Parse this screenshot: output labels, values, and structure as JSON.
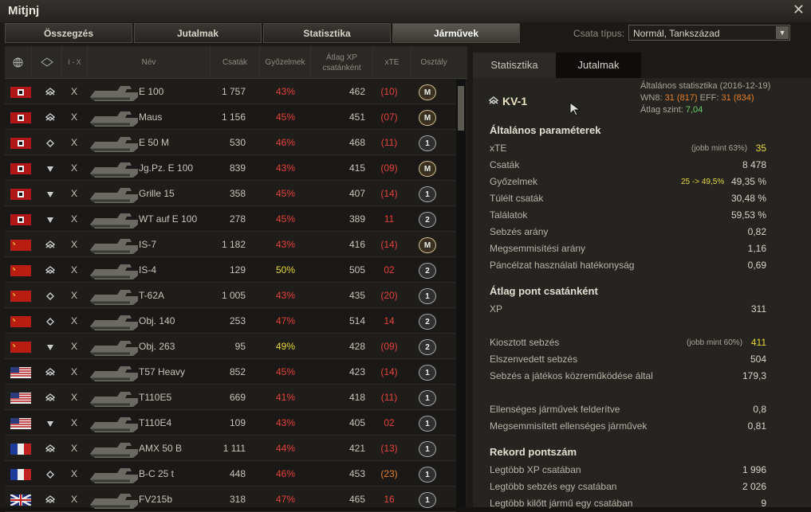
{
  "window": {
    "title": "Mitjnj"
  },
  "tabs": [
    "Összegzés",
    "Jutalmak",
    "Statisztika",
    "Járművek"
  ],
  "battle_type": {
    "label": "Csata típus:",
    "value": "Normál, Tankszázad"
  },
  "columns": {
    "tier": "I - X",
    "name": "Név",
    "battles": "Csaták",
    "wins": "Győzelmek",
    "avg_xp": "Átlag XP csatánként",
    "xte": "xTE",
    "class": "Osztály"
  },
  "rows": [
    {
      "flag": "de",
      "type": "heavy",
      "tier": "X",
      "name": "E 100",
      "battles": "1 757",
      "wins": "43%",
      "wc": "red",
      "avgxp": "462",
      "xte": "(10)",
      "xc": "red",
      "badge": "M"
    },
    {
      "flag": "de",
      "type": "heavy",
      "tier": "X",
      "name": "Maus",
      "battles": "1 156",
      "wins": "45%",
      "wc": "red",
      "avgxp": "451",
      "xte": "(07)",
      "xc": "red",
      "badge": "M"
    },
    {
      "flag": "de",
      "type": "medium",
      "tier": "X",
      "name": "E 50 M",
      "battles": "530",
      "wins": "46%",
      "wc": "red",
      "avgxp": "468",
      "xte": "(11)",
      "xc": "red",
      "badge": "1"
    },
    {
      "flag": "de",
      "type": "td",
      "tier": "X",
      "name": "Jg.Pz. E 100",
      "battles": "839",
      "wins": "43%",
      "wc": "red",
      "avgxp": "415",
      "xte": "(09)",
      "xc": "red",
      "badge": "M"
    },
    {
      "flag": "de",
      "type": "td",
      "tier": "X",
      "name": "Grille 15",
      "battles": "358",
      "wins": "45%",
      "wc": "red",
      "avgxp": "407",
      "xte": "(14)",
      "xc": "red",
      "badge": "1"
    },
    {
      "flag": "de",
      "type": "td",
      "tier": "X",
      "name": "WT auf E 100",
      "battles": "278",
      "wins": "45%",
      "wc": "red",
      "avgxp": "389",
      "xte": "11",
      "xc": "red",
      "badge": "2"
    },
    {
      "flag": "su",
      "type": "heavy",
      "tier": "X",
      "name": "IS-7",
      "battles": "1 182",
      "wins": "43%",
      "wc": "red",
      "avgxp": "416",
      "xte": "(14)",
      "xc": "red",
      "badge": "M"
    },
    {
      "flag": "su",
      "type": "heavy",
      "tier": "X",
      "name": "IS-4",
      "battles": "129",
      "wins": "50%",
      "wc": "yel",
      "avgxp": "505",
      "xte": "02",
      "xc": "red",
      "badge": "2"
    },
    {
      "flag": "su",
      "type": "medium",
      "tier": "X",
      "name": "T-62A",
      "battles": "1 005",
      "wins": "43%",
      "wc": "red",
      "avgxp": "435",
      "xte": "(20)",
      "xc": "red",
      "badge": "1"
    },
    {
      "flag": "su",
      "type": "medium",
      "tier": "X",
      "name": "Obj. 140",
      "battles": "253",
      "wins": "47%",
      "wc": "red",
      "avgxp": "514",
      "xte": "14",
      "xc": "red",
      "badge": "2"
    },
    {
      "flag": "su",
      "type": "td",
      "tier": "X",
      "name": "Obj. 263",
      "battles": "95",
      "wins": "49%",
      "wc": "yel",
      "avgxp": "428",
      "xte": "(09)",
      "xc": "red",
      "badge": "2"
    },
    {
      "flag": "us",
      "type": "heavy",
      "tier": "X",
      "name": "T57 Heavy",
      "battles": "852",
      "wins": "45%",
      "wc": "red",
      "avgxp": "423",
      "xte": "(14)",
      "xc": "red",
      "badge": "1"
    },
    {
      "flag": "us",
      "type": "heavy",
      "tier": "X",
      "name": "T110E5",
      "battles": "669",
      "wins": "41%",
      "wc": "red",
      "avgxp": "418",
      "xte": "(11)",
      "xc": "red",
      "badge": "1"
    },
    {
      "flag": "us",
      "type": "td",
      "tier": "X",
      "name": "T110E4",
      "battles": "109",
      "wins": "43%",
      "wc": "red",
      "avgxp": "405",
      "xte": "02",
      "xc": "red",
      "badge": "1"
    },
    {
      "flag": "fr",
      "type": "heavy",
      "tier": "X",
      "name": "AMX 50 B",
      "battles": "1 111",
      "wins": "44%",
      "wc": "red",
      "avgxp": "421",
      "xte": "(13)",
      "xc": "red",
      "badge": "1"
    },
    {
      "flag": "fr",
      "type": "medium",
      "tier": "X",
      "name": "B-C 25 t",
      "battles": "448",
      "wins": "46%",
      "wc": "red",
      "avgxp": "453",
      "xte": "(23)",
      "xc": "org",
      "badge": "1"
    },
    {
      "flag": "uk",
      "type": "heavy",
      "tier": "X",
      "name": "FV215b",
      "battles": "318",
      "wins": "47%",
      "wc": "red",
      "avgxp": "465",
      "xte": "16",
      "xc": "red",
      "badge": "1"
    }
  ],
  "right": {
    "tabs": [
      "Statisztika",
      "Jutalmak"
    ],
    "vehicle": "KV-1",
    "general_title": "Általános statisztika (2016-12-19)",
    "wn8_label": "WN8:",
    "wn8": "31",
    "wn8_b": "(817)",
    "eff_label": "EFF:",
    "eff": "31",
    "eff_b": "(834)",
    "avg_tier_label": "Átlag szint:",
    "avg_tier": "7,04",
    "sec1": "Általános paraméterek",
    "xte_label": "xTE",
    "xte_note": "(jobb mint 63%)",
    "xte": "35",
    "battles_label": "Csaták",
    "battles": "8 478",
    "wins_label": "Győzelmek",
    "wins_note": "25 -> 49,5%",
    "wins": "49,35 %",
    "survived_label": "Túlélt csaták",
    "survived": "30,48 %",
    "hits_label": "Találatok",
    "hits": "59,53 %",
    "dmg_ratio_label": "Sebzés arány",
    "dmg_ratio": "0,82",
    "kill_ratio_label": "Megsemmisítési arány",
    "kill_ratio": "1,16",
    "armor_label": "Páncélzat használati hatékonyság",
    "armor": "0,69",
    "sec2": "Átlag pont csatánként",
    "xp_label": "XP",
    "xp": "311",
    "dealt_label": "Kiosztott sebzés",
    "dealt_note": "(jobb mint 60%)",
    "dealt": "411",
    "received_label": "Elszenvedett sebzés",
    "received": "504",
    "assist_label": "Sebzés a játékos közreműködése által",
    "assist": "179,3",
    "spotted_label": "Ellenséges járművek felderítve",
    "spotted": "0,8",
    "killed_label": "Megsemmisített ellenséges járművek",
    "killed": "0,81",
    "sec3": "Rekord pontszám",
    "maxxp_label": "Legtöbb XP csatában",
    "maxxp": "1 996",
    "maxdmg_label": "Legtöbb sebzés egy csatában",
    "maxdmg": "2 026",
    "maxkill_label": "Legtöbb kilőtt jármű egy csatában",
    "maxkill": "9"
  }
}
